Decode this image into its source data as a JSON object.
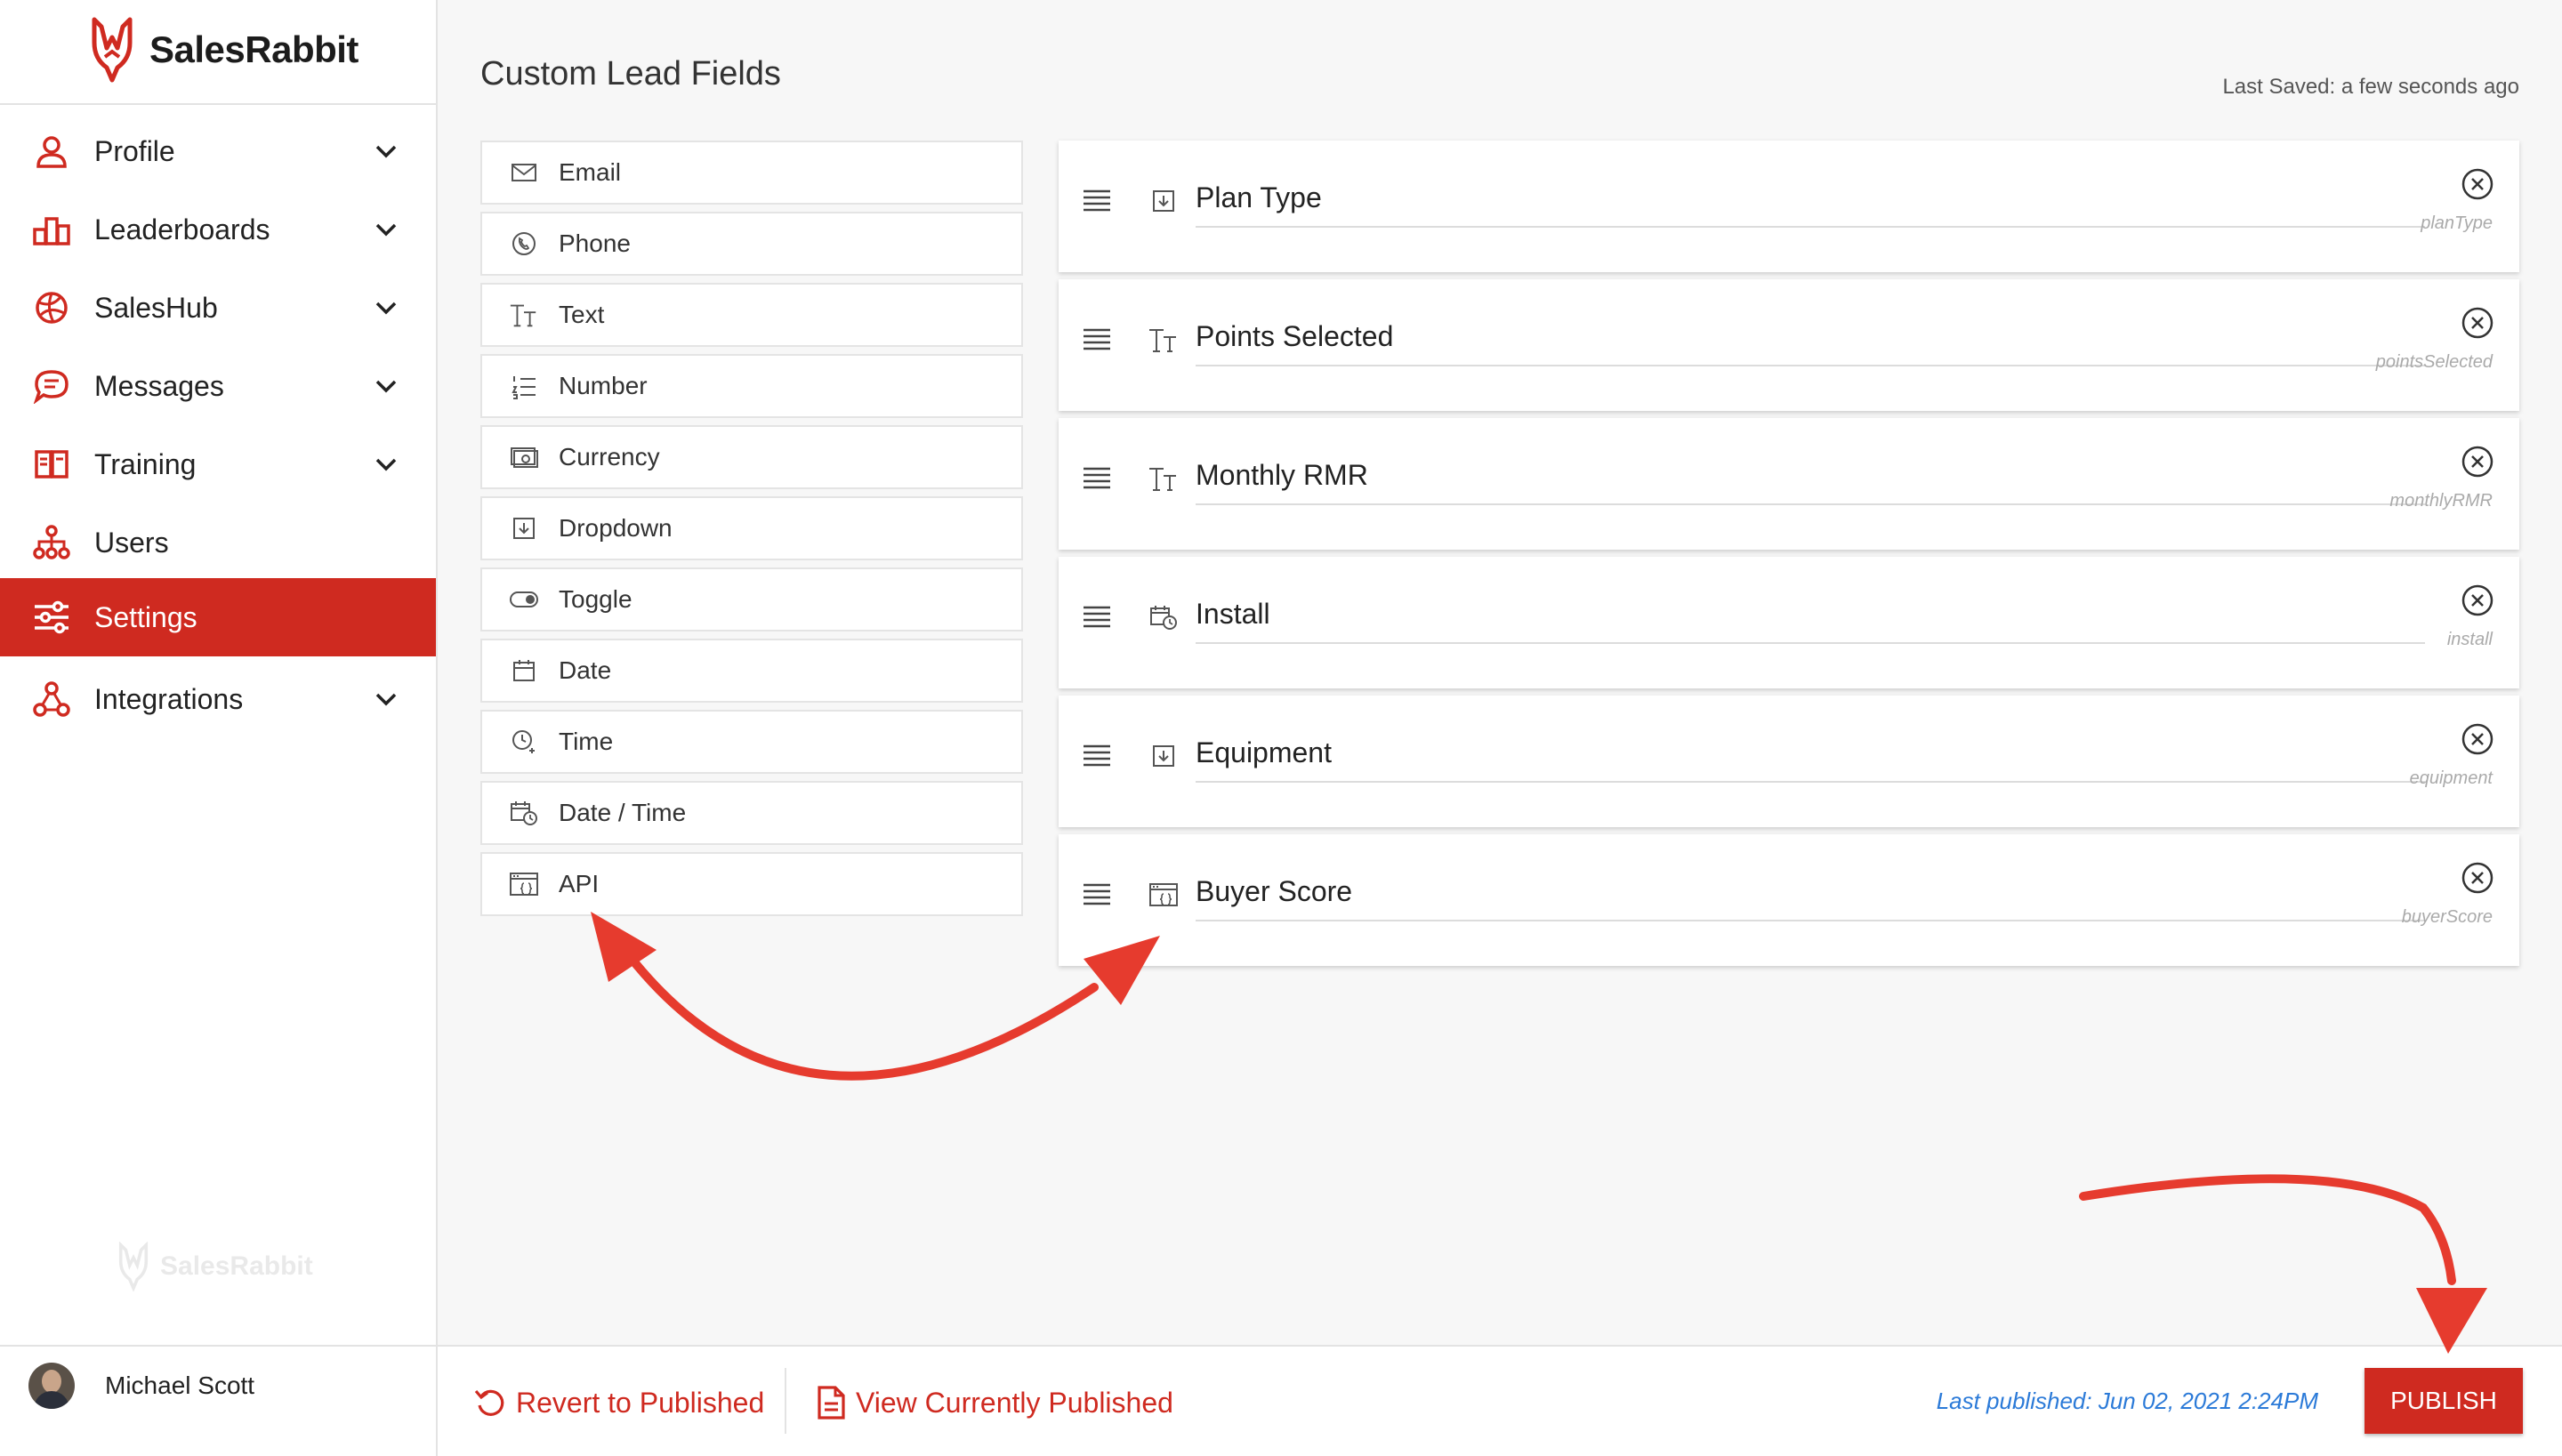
{
  "app": {
    "name": "SalesRabbit",
    "watermark": "SalesRabbit"
  },
  "colors": {
    "accent": "#cf2a20",
    "link_blue": "#2b7ad8",
    "annotation": "#e63b2e"
  },
  "sidebar": {
    "items": [
      {
        "label": "Profile",
        "icon": "user-icon",
        "expandable": true
      },
      {
        "label": "Leaderboards",
        "icon": "leaderboard-icon",
        "expandable": true
      },
      {
        "label": "SalesHub",
        "icon": "globe-icon",
        "expandable": true
      },
      {
        "label": "Messages",
        "icon": "message-icon",
        "expandable": true
      },
      {
        "label": "Training",
        "icon": "training-book-icon",
        "expandable": true
      },
      {
        "label": "Users",
        "icon": "users-tree-icon",
        "expandable": false
      },
      {
        "label": "Settings",
        "icon": "sliders-icon",
        "expandable": false,
        "active": true
      },
      {
        "label": "Integrations",
        "icon": "integrations-icon",
        "expandable": true
      }
    ],
    "user": {
      "name": "Michael Scott"
    }
  },
  "main": {
    "title": "Custom Lead Fields",
    "last_saved_label": "Last Saved:",
    "last_saved_value": "a few seconds ago",
    "palette": [
      {
        "label": "Email",
        "icon": "email-icon"
      },
      {
        "label": "Phone",
        "icon": "phone-icon"
      },
      {
        "label": "Text",
        "icon": "text-icon"
      },
      {
        "label": "Number",
        "icon": "number-list-icon"
      },
      {
        "label": "Currency",
        "icon": "currency-icon"
      },
      {
        "label": "Dropdown",
        "icon": "dropdown-icon"
      },
      {
        "label": "Toggle",
        "icon": "toggle-icon"
      },
      {
        "label": "Date",
        "icon": "calendar-icon"
      },
      {
        "label": "Time",
        "icon": "clock-icon"
      },
      {
        "label": "Date / Time",
        "icon": "datetime-icon"
      },
      {
        "label": "API",
        "icon": "api-icon"
      }
    ],
    "fields": [
      {
        "name": "Plan Type",
        "key": "planType",
        "icon": "dropdown-icon"
      },
      {
        "name": "Points Selected",
        "key": "pointsSelected",
        "icon": "text-icon"
      },
      {
        "name": "Monthly RMR",
        "key": "monthlyRMR",
        "icon": "text-icon"
      },
      {
        "name": "Install",
        "key": "install",
        "icon": "datetime-icon"
      },
      {
        "name": "Equipment",
        "key": "equipment",
        "icon": "dropdown-icon"
      },
      {
        "name": "Buyer Score",
        "key": "buyerScore",
        "icon": "api-icon"
      }
    ]
  },
  "footer": {
    "revert_label": "Revert to Published",
    "view_label": "View Currently Published",
    "last_published": "Last published: Jun 02, 2021 2:24PM",
    "publish_label": "PUBLISH"
  }
}
